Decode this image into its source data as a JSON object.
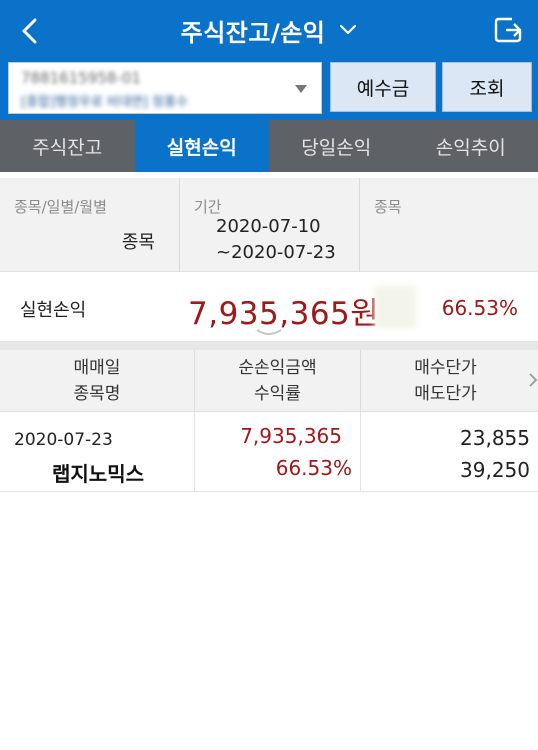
{
  "header": {
    "title": "주식잔고/손익",
    "colors": {
      "primary": "#0a72c8",
      "loss_red": "#a01818",
      "tab_bar": "#5e6165"
    },
    "icons": [
      "back-arrow-icon",
      "chevron-down-icon",
      "share-export-icon"
    ]
  },
  "account": {
    "number": "7881615958-01",
    "name": "[종합]행정우로 비대면] 정홍수"
  },
  "buttons": {
    "deposit": "예수금",
    "query": "조회"
  },
  "tabs": [
    {
      "label": "주식잔고",
      "active": false
    },
    {
      "label": "실현손익",
      "active": true
    },
    {
      "label": "당일손익",
      "active": false
    },
    {
      "label": "손익추이",
      "active": false
    }
  ],
  "filter": {
    "type_label": "종목/일별/월별",
    "type_value": "종목",
    "period_label": "기간",
    "period_start": "2020-07-10",
    "period_end": "~2020-07-23",
    "stock_label": "종목"
  },
  "summary": {
    "label": "실현손익",
    "amount": "7,935,365원",
    "rate": "66.53%"
  },
  "table": {
    "headers": {
      "col1_line1": "매매일",
      "col1_line2": "종목명",
      "col2_line1": "순손익금액",
      "col2_line2": "수익률",
      "col3_line1": "매수단가",
      "col3_line2": "매도단가"
    },
    "rows": [
      {
        "date": "2020-07-23",
        "name": "랩지노믹스",
        "net_profit": "7,935,365",
        "rate": "66.53%",
        "buy_price": "23,855",
        "sell_price": "39,250"
      }
    ]
  }
}
